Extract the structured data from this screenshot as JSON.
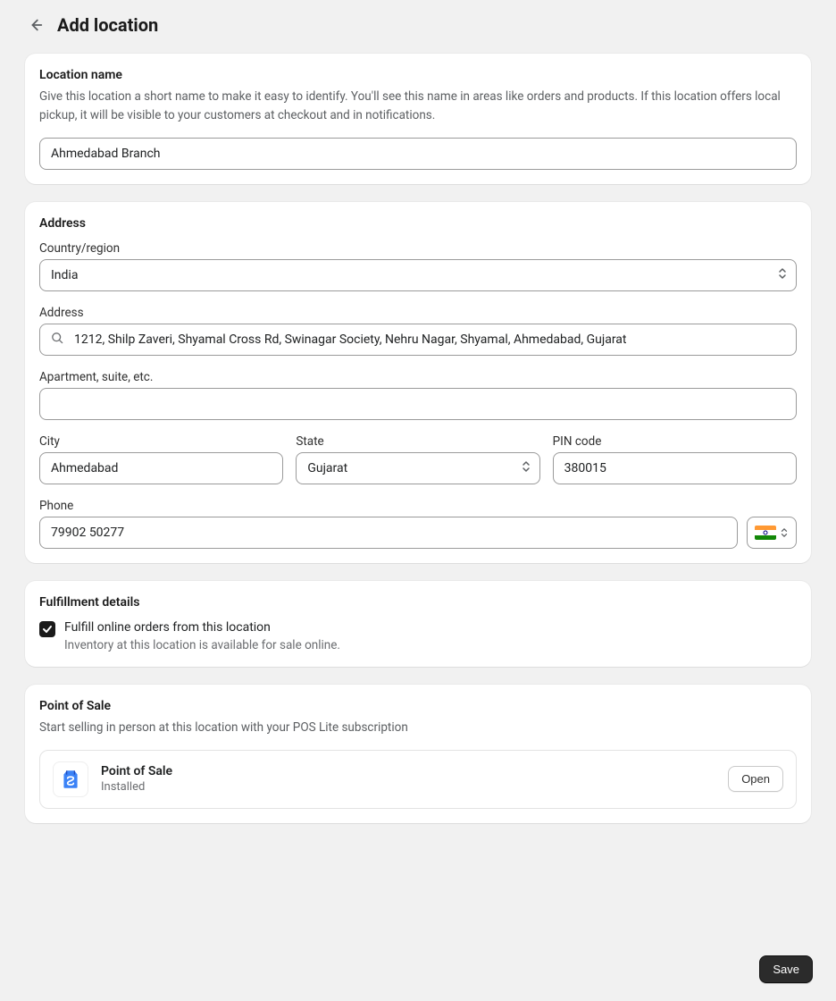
{
  "header": {
    "title": "Add location"
  },
  "location_name_card": {
    "title": "Location name",
    "description": "Give this location a short name to make it easy to identify. You'll see this name in areas like orders and products. If this location offers local pickup, it will be visible to your customers at checkout and in notifications.",
    "value": "Ahmedabad Branch"
  },
  "address_card": {
    "title": "Address",
    "country_label": "Country/region",
    "country_value": "India",
    "address_label": "Address",
    "address_value": "1212, Shilp Zaveri, Shyamal Cross Rd, Swinagar Society, Nehru Nagar, Shyamal, Ahmedabad, Gujarat",
    "apt_label": "Apartment, suite, etc.",
    "apt_value": "",
    "city_label": "City",
    "city_value": "Ahmedabad",
    "state_label": "State",
    "state_value": "Gujarat",
    "pin_label": "PIN code",
    "pin_value": "380015",
    "phone_label": "Phone",
    "phone_value": "79902 50277",
    "phone_country": "India"
  },
  "fulfillment_card": {
    "title": "Fulfillment details",
    "checkbox_label": "Fulfill online orders from this location",
    "checkbox_sub": "Inventory at this location is available for sale online.",
    "checked": true
  },
  "pos_card": {
    "title": "Point of Sale",
    "description": "Start selling in person at this location with your POS Lite subscription",
    "app_name": "Point of Sale",
    "app_status": "Installed",
    "open_label": "Open"
  },
  "footer": {
    "save_label": "Save"
  }
}
